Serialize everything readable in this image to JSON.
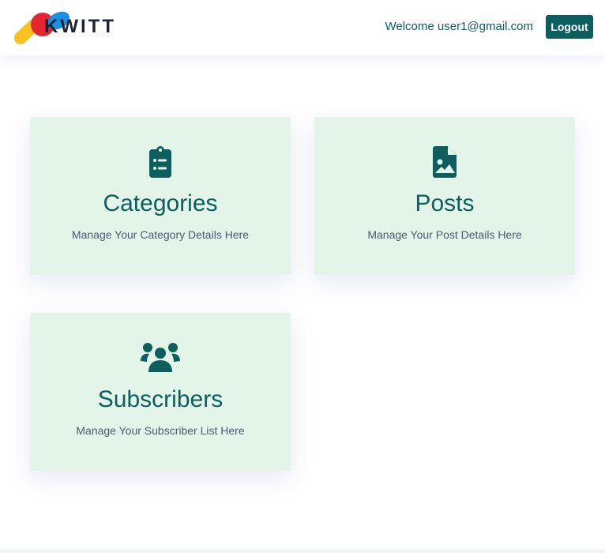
{
  "brand": {
    "name": "KWITT",
    "colors": {
      "yellow": "#f7c31f",
      "red": "#e3262f",
      "blue": "#1b8fe3",
      "dark": "#1f2430"
    }
  },
  "header": {
    "welcome_text": "Welcome user1@gmail.com",
    "logout_label": "Logout"
  },
  "cards": [
    {
      "icon": "clipboard-list-icon",
      "title": "Categories",
      "description": "Manage Your Category Details Here"
    },
    {
      "icon": "file-image-icon",
      "title": "Posts",
      "description": "Manage Your Post Details Here"
    },
    {
      "icon": "users-icon",
      "title": "Subscribers",
      "description": "Manage Your Subscriber List Here"
    }
  ],
  "theme": {
    "accent": "#0d5e5e",
    "card_background": "#e3f4e8",
    "description_text": "#4a5a72"
  }
}
